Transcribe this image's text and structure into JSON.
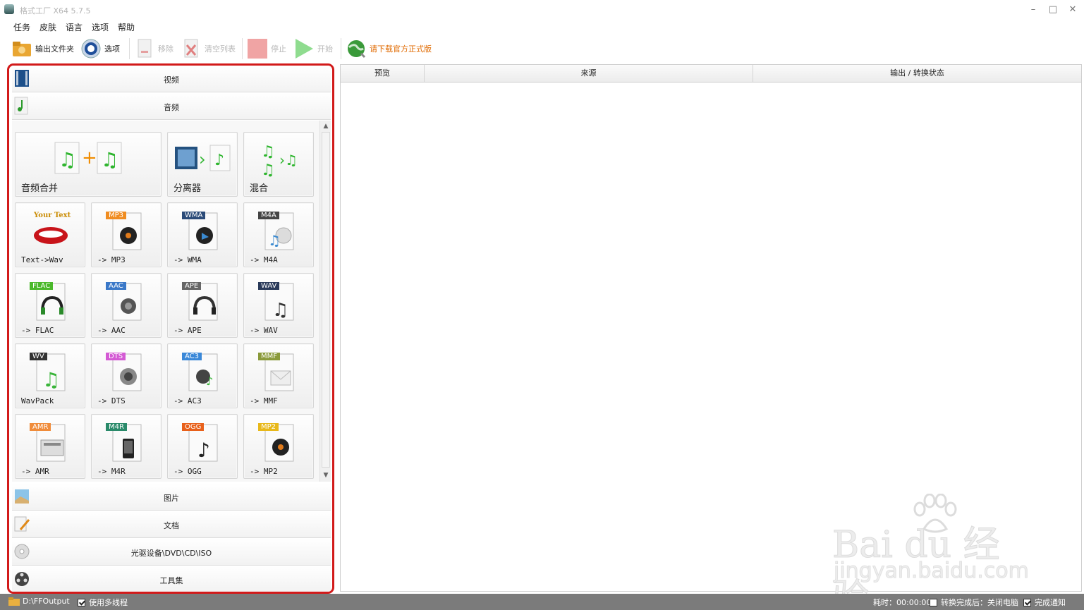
{
  "window": {
    "title": "格式工厂 X64 5.7.5",
    "minimize": "–",
    "maximize": "□",
    "close": "✕"
  },
  "menu": [
    "任务",
    "皮肤",
    "语言",
    "选项",
    "帮助"
  ],
  "toolbar": {
    "output_folder": "输出文件夹",
    "options": "选项",
    "remove": "移除",
    "clear_list": "清空列表",
    "stop": "停止",
    "start": "开始",
    "download": "请下载官方正式版"
  },
  "categories": {
    "video": "视频",
    "audio": "音频",
    "image": "图片",
    "document": "文档",
    "disc": "光驱设备\\DVD\\CD\\ISO",
    "tools": "工具集"
  },
  "tiles": [
    {
      "label": "音频合并",
      "icon": "audio-merge-icon"
    },
    {
      "label": "分离器",
      "icon": "splitter-icon"
    },
    {
      "label": "混合",
      "icon": "mix-icon"
    },
    {
      "label": "Text->Wav",
      "icon": "text-to-speech-icon",
      "badge": "Your Text"
    },
    {
      "label": "-> MP3",
      "icon": "mp3-file-icon",
      "badge": "MP3"
    },
    {
      "label": "-> WMA",
      "icon": "wma-file-icon",
      "badge": "WMA"
    },
    {
      "label": "-> M4A",
      "icon": "m4a-file-icon",
      "badge": "M4A"
    },
    {
      "label": "-> FLAC",
      "icon": "flac-file-icon",
      "badge": "FLAC"
    },
    {
      "label": "-> AAC",
      "icon": "aac-file-icon",
      "badge": "AAC"
    },
    {
      "label": "-> APE",
      "icon": "ape-file-icon",
      "badge": "APE"
    },
    {
      "label": "-> WAV",
      "icon": "wav-file-icon",
      "badge": "WAV"
    },
    {
      "label": "WavPack",
      "icon": "wv-file-icon",
      "badge": "WV"
    },
    {
      "label": "-> DTS",
      "icon": "dts-file-icon",
      "badge": "DTS"
    },
    {
      "label": "-> AC3",
      "icon": "ac3-file-icon",
      "badge": "AC3"
    },
    {
      "label": "-> MMF",
      "icon": "mmf-file-icon",
      "badge": "MMF"
    },
    {
      "label": "-> AMR",
      "icon": "amr-file-icon",
      "badge": "AMR"
    },
    {
      "label": "-> M4R",
      "icon": "m4r-file-icon",
      "badge": "M4R"
    },
    {
      "label": "-> OGG",
      "icon": "ogg-file-icon",
      "badge": "OGG"
    },
    {
      "label": "-> MP2",
      "icon": "mp2-file-icon",
      "badge": "MP2"
    }
  ],
  "table": {
    "columns": [
      "预览",
      "来源",
      "输出 / 转换状态"
    ]
  },
  "watermark": {
    "brand": "Bai du 经验",
    "url": "jingyan.baidu.com"
  },
  "status": {
    "output_path": "D:\\FFOutput",
    "multithread": "使用多线程",
    "elapsed": "耗时：00:00:00",
    "after_convert": "转换完成后：关闭电脑",
    "notify": "完成通知"
  },
  "colors": {
    "highlight_border": "#d21a1a",
    "accent_orange": "#e06a00",
    "statusbar": "#7b7b7b"
  }
}
